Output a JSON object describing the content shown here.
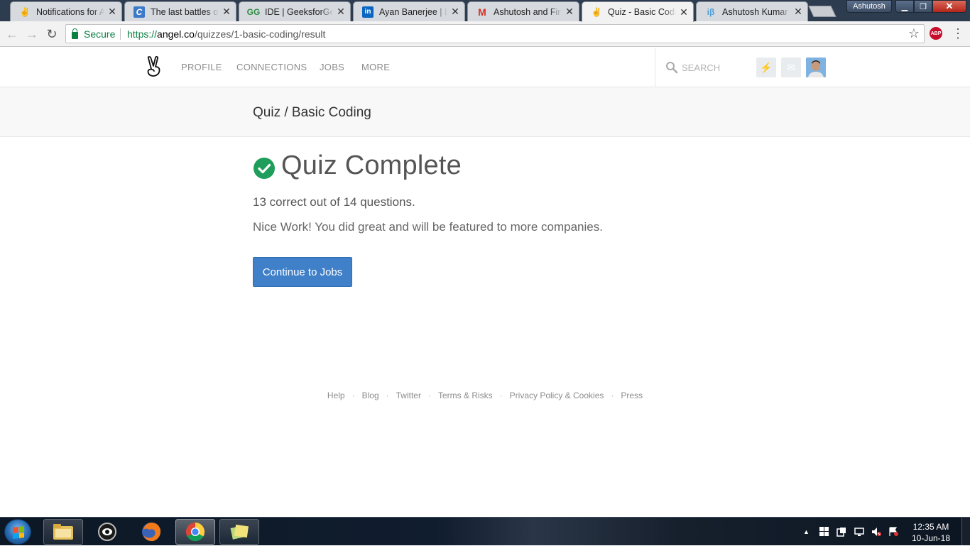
{
  "browser": {
    "tabs": [
      {
        "title": "Notifications for Ashutosh",
        "favicon": "angellist-icon"
      },
      {
        "title": "The last battles of Usain Bolt",
        "favicon": "c-icon"
      },
      {
        "title": "IDE | GeeksforGeeks",
        "favicon": "geeksforgeeks-icon"
      },
      {
        "title": "Ayan Banerjee | LinkedIn",
        "favicon": "linkedin-icon"
      },
      {
        "title": "Ashutosh and Findo",
        "favicon": "gmail-icon"
      },
      {
        "title": "Quiz - Basic Coding",
        "favicon": "angellist-icon",
        "active": true
      },
      {
        "title": "Ashutosh Kumar on",
        "favicon": "blog-icon"
      }
    ],
    "profile_name": "Ashutosh",
    "secure_label": "Secure",
    "url_scheme": "https://",
    "url_host": "angel.co",
    "url_path": "/quizzes/1-basic-coding/result",
    "abp_label": "ABP"
  },
  "header": {
    "nav": [
      "PROFILE",
      "CONNECTIONS",
      "JOBS",
      "MORE"
    ],
    "search_placeholder": "SEARCH"
  },
  "quiz": {
    "breadcrumb": "Quiz / Basic Coding",
    "title": "Quiz Complete",
    "score_text": "13 correct out of 14 questions.",
    "praise_text": "Nice Work! You did great and will be featured to more companies.",
    "cta_label": "Continue to Jobs"
  },
  "footer": {
    "links": [
      "Help",
      "Blog",
      "Twitter",
      "Terms & Risks",
      "Privacy Policy & Cookies",
      "Press"
    ]
  },
  "taskbar": {
    "time": "12:35 AM",
    "date": "10-Jun-18"
  },
  "colors": {
    "accent": "#3f80c9",
    "success": "#1e9e5a",
    "secure_green": "#0b8043"
  }
}
